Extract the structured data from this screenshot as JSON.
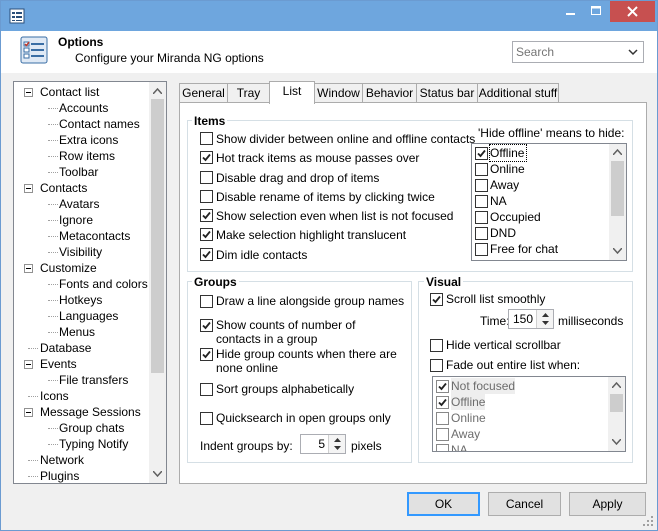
{
  "window": {
    "app_icon": "miranda-options-icon"
  },
  "header": {
    "title": "Options",
    "subtitle": "Configure your Miranda NG options"
  },
  "search": {
    "placeholder": "Search"
  },
  "tree": [
    {
      "label": "Contact list",
      "level": 0,
      "expanded": true
    },
    {
      "label": "Accounts",
      "level": 1
    },
    {
      "label": "Contact names",
      "level": 1
    },
    {
      "label": "Extra icons",
      "level": 1
    },
    {
      "label": "Row items",
      "level": 1
    },
    {
      "label": "Toolbar",
      "level": 1
    },
    {
      "label": "Contacts",
      "level": 0,
      "expanded": true
    },
    {
      "label": "Avatars",
      "level": 1
    },
    {
      "label": "Ignore",
      "level": 1
    },
    {
      "label": "Metacontacts",
      "level": 1
    },
    {
      "label": "Visibility",
      "level": 1
    },
    {
      "label": "Customize",
      "level": 0,
      "expanded": true
    },
    {
      "label": "Fonts and colors",
      "level": 1
    },
    {
      "label": "Hotkeys",
      "level": 1
    },
    {
      "label": "Languages",
      "level": 1
    },
    {
      "label": "Menus",
      "level": 1
    },
    {
      "label": "Database",
      "level": 0
    },
    {
      "label": "Events",
      "level": 0,
      "expanded": true
    },
    {
      "label": "File transfers",
      "level": 1
    },
    {
      "label": "Icons",
      "level": 0
    },
    {
      "label": "Message Sessions",
      "level": 0,
      "expanded": true
    },
    {
      "label": "Group chats",
      "level": 1
    },
    {
      "label": "Typing Notify",
      "level": 1
    },
    {
      "label": "Network",
      "level": 0
    },
    {
      "label": "Plugins",
      "level": 0
    }
  ],
  "tabs": [
    "General",
    "Tray",
    "List",
    "Window",
    "Behavior",
    "Status bar",
    "Additional stuff"
  ],
  "active_tab": "List",
  "items": {
    "title": "Items",
    "options": [
      {
        "label": "Show divider between online and offline contacts",
        "checked": false
      },
      {
        "label": "Hot track items as mouse passes over",
        "checked": true
      },
      {
        "label": "Disable drag and drop of items",
        "checked": false
      },
      {
        "label": "Disable rename of items by clicking twice",
        "checked": false
      },
      {
        "label": "Show selection even when list is not focused",
        "checked": true
      },
      {
        "label": "Make selection highlight translucent",
        "checked": true
      },
      {
        "label": "Dim idle contacts",
        "checked": true
      }
    ],
    "hide_offline_label": "'Hide offline' means to hide:",
    "hide_offline": [
      {
        "label": "Offline",
        "checked": true
      },
      {
        "label": "Online",
        "checked": false
      },
      {
        "label": "Away",
        "checked": false
      },
      {
        "label": "NA",
        "checked": false
      },
      {
        "label": "Occupied",
        "checked": false
      },
      {
        "label": "DND",
        "checked": false
      },
      {
        "label": "Free for chat",
        "checked": false
      }
    ]
  },
  "groups": {
    "title": "Groups",
    "options": [
      {
        "label": "Draw a line alongside group names",
        "checked": false
      },
      {
        "label": "Show counts of number of contacts in a group",
        "checked": true
      },
      {
        "label": "Hide group counts when there are none online",
        "checked": true
      },
      {
        "label": "Sort groups alphabetically",
        "checked": false
      },
      {
        "label": "Quicksearch in open groups only",
        "checked": false
      }
    ],
    "indent_label": "Indent groups by:",
    "indent_value": "5",
    "indent_unit": "pixels"
  },
  "visual": {
    "title": "Visual",
    "scroll_smoothly": {
      "label": "Scroll list smoothly",
      "checked": true
    },
    "time_label": "Time:",
    "time_value": "150",
    "time_unit": "milliseconds",
    "hide_scrollbar": {
      "label": "Hide vertical scrollbar",
      "checked": false
    },
    "fade_out": {
      "label": "Fade out entire list when:",
      "checked": false
    },
    "fade_list": [
      {
        "label": "Not focused",
        "checked": true
      },
      {
        "label": "Offline",
        "checked": true
      },
      {
        "label": "Online",
        "checked": false
      },
      {
        "label": "Away",
        "checked": false
      },
      {
        "label": "NA",
        "checked": false
      }
    ]
  },
  "buttons": {
    "ok": "OK",
    "cancel": "Cancel",
    "apply": "Apply"
  }
}
